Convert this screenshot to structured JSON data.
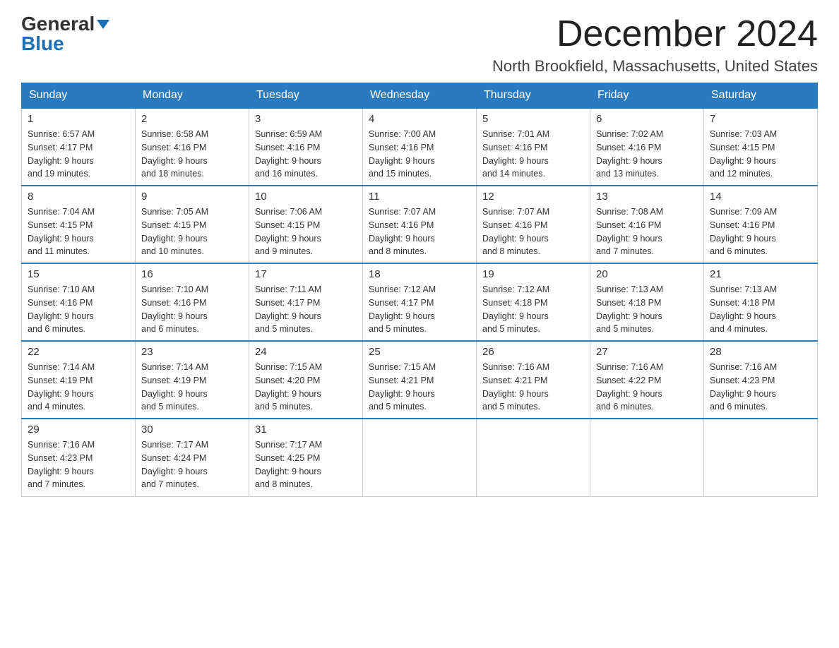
{
  "header": {
    "logo_general": "General",
    "logo_blue": "Blue",
    "month_title": "December 2024",
    "location": "North Brookfield, Massachusetts, United States"
  },
  "days_of_week": [
    "Sunday",
    "Monday",
    "Tuesday",
    "Wednesday",
    "Thursday",
    "Friday",
    "Saturday"
  ],
  "weeks": [
    [
      {
        "day": "1",
        "sunrise": "6:57 AM",
        "sunset": "4:17 PM",
        "daylight": "9 hours and 19 minutes."
      },
      {
        "day": "2",
        "sunrise": "6:58 AM",
        "sunset": "4:16 PM",
        "daylight": "9 hours and 18 minutes."
      },
      {
        "day": "3",
        "sunrise": "6:59 AM",
        "sunset": "4:16 PM",
        "daylight": "9 hours and 16 minutes."
      },
      {
        "day": "4",
        "sunrise": "7:00 AM",
        "sunset": "4:16 PM",
        "daylight": "9 hours and 15 minutes."
      },
      {
        "day": "5",
        "sunrise": "7:01 AM",
        "sunset": "4:16 PM",
        "daylight": "9 hours and 14 minutes."
      },
      {
        "day": "6",
        "sunrise": "7:02 AM",
        "sunset": "4:16 PM",
        "daylight": "9 hours and 13 minutes."
      },
      {
        "day": "7",
        "sunrise": "7:03 AM",
        "sunset": "4:15 PM",
        "daylight": "9 hours and 12 minutes."
      }
    ],
    [
      {
        "day": "8",
        "sunrise": "7:04 AM",
        "sunset": "4:15 PM",
        "daylight": "9 hours and 11 minutes."
      },
      {
        "day": "9",
        "sunrise": "7:05 AM",
        "sunset": "4:15 PM",
        "daylight": "9 hours and 10 minutes."
      },
      {
        "day": "10",
        "sunrise": "7:06 AM",
        "sunset": "4:15 PM",
        "daylight": "9 hours and 9 minutes."
      },
      {
        "day": "11",
        "sunrise": "7:07 AM",
        "sunset": "4:16 PM",
        "daylight": "9 hours and 8 minutes."
      },
      {
        "day": "12",
        "sunrise": "7:07 AM",
        "sunset": "4:16 PM",
        "daylight": "9 hours and 8 minutes."
      },
      {
        "day": "13",
        "sunrise": "7:08 AM",
        "sunset": "4:16 PM",
        "daylight": "9 hours and 7 minutes."
      },
      {
        "day": "14",
        "sunrise": "7:09 AM",
        "sunset": "4:16 PM",
        "daylight": "9 hours and 6 minutes."
      }
    ],
    [
      {
        "day": "15",
        "sunrise": "7:10 AM",
        "sunset": "4:16 PM",
        "daylight": "9 hours and 6 minutes."
      },
      {
        "day": "16",
        "sunrise": "7:10 AM",
        "sunset": "4:16 PM",
        "daylight": "9 hours and 6 minutes."
      },
      {
        "day": "17",
        "sunrise": "7:11 AM",
        "sunset": "4:17 PM",
        "daylight": "9 hours and 5 minutes."
      },
      {
        "day": "18",
        "sunrise": "7:12 AM",
        "sunset": "4:17 PM",
        "daylight": "9 hours and 5 minutes."
      },
      {
        "day": "19",
        "sunrise": "7:12 AM",
        "sunset": "4:18 PM",
        "daylight": "9 hours and 5 minutes."
      },
      {
        "day": "20",
        "sunrise": "7:13 AM",
        "sunset": "4:18 PM",
        "daylight": "9 hours and 5 minutes."
      },
      {
        "day": "21",
        "sunrise": "7:13 AM",
        "sunset": "4:18 PM",
        "daylight": "9 hours and 4 minutes."
      }
    ],
    [
      {
        "day": "22",
        "sunrise": "7:14 AM",
        "sunset": "4:19 PM",
        "daylight": "9 hours and 4 minutes."
      },
      {
        "day": "23",
        "sunrise": "7:14 AM",
        "sunset": "4:19 PM",
        "daylight": "9 hours and 5 minutes."
      },
      {
        "day": "24",
        "sunrise": "7:15 AM",
        "sunset": "4:20 PM",
        "daylight": "9 hours and 5 minutes."
      },
      {
        "day": "25",
        "sunrise": "7:15 AM",
        "sunset": "4:21 PM",
        "daylight": "9 hours and 5 minutes."
      },
      {
        "day": "26",
        "sunrise": "7:16 AM",
        "sunset": "4:21 PM",
        "daylight": "9 hours and 5 minutes."
      },
      {
        "day": "27",
        "sunrise": "7:16 AM",
        "sunset": "4:22 PM",
        "daylight": "9 hours and 6 minutes."
      },
      {
        "day": "28",
        "sunrise": "7:16 AM",
        "sunset": "4:23 PM",
        "daylight": "9 hours and 6 minutes."
      }
    ],
    [
      {
        "day": "29",
        "sunrise": "7:16 AM",
        "sunset": "4:23 PM",
        "daylight": "9 hours and 7 minutes."
      },
      {
        "day": "30",
        "sunrise": "7:17 AM",
        "sunset": "4:24 PM",
        "daylight": "9 hours and 7 minutes."
      },
      {
        "day": "31",
        "sunrise": "7:17 AM",
        "sunset": "4:25 PM",
        "daylight": "9 hours and 8 minutes."
      },
      null,
      null,
      null,
      null
    ]
  ]
}
